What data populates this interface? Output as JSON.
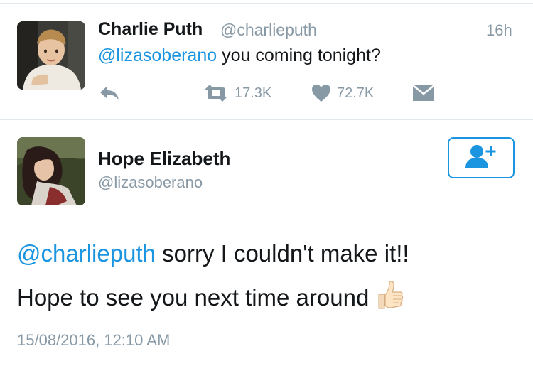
{
  "reply_tweet": {
    "name": "Charlie Puth",
    "handle": "@charlieputh",
    "time": "16h",
    "mention": "@lizasoberano",
    "text": " you coming tonight?",
    "retweets": "17.3K",
    "likes": "72.7K"
  },
  "main_tweet": {
    "name": "Hope Elizabeth",
    "handle": "@lizasoberano",
    "mention": "@charlieputh",
    "text_line1": " sorry I couldn't make it!!",
    "text_line2": "Hope to see you next time around",
    "emoji": "thumbs-up",
    "timestamp": "15/08/2016, 12:10 AM"
  },
  "icons": {
    "reply": "reply-icon",
    "retweet": "retweet-icon",
    "like": "heart-icon",
    "dm": "envelope-icon",
    "follow": "follow-user-icon"
  },
  "colors": {
    "accent": "#1b95e0",
    "muted": "#8899a6",
    "text": "#14171a"
  }
}
